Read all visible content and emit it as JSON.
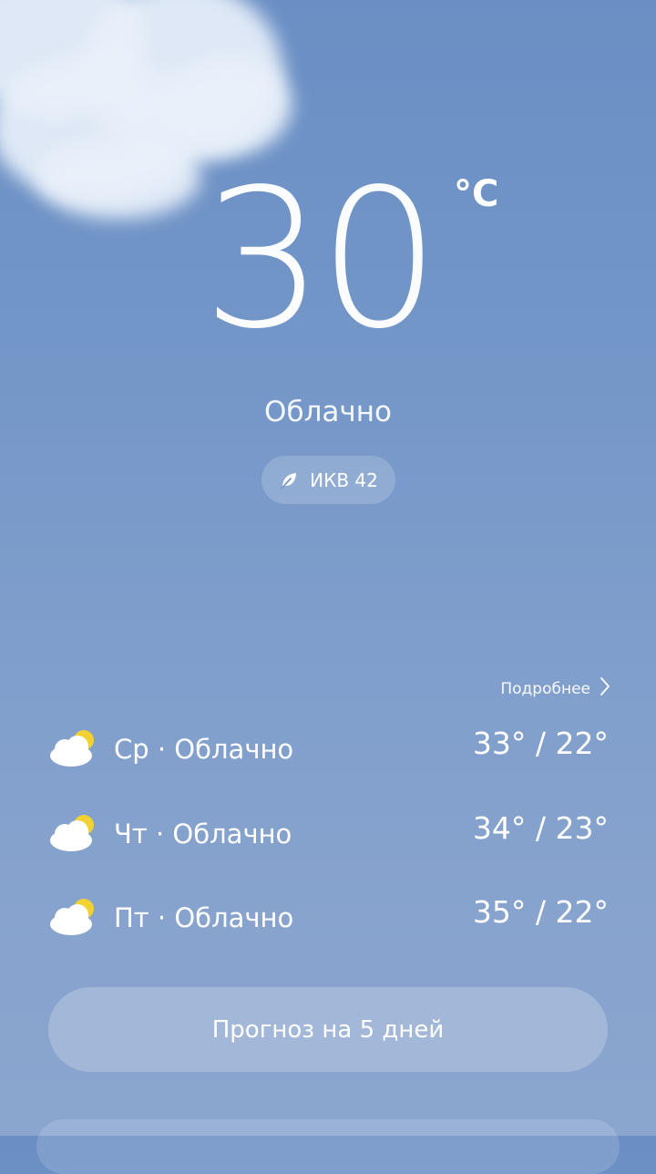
{
  "current": {
    "temperature": "30",
    "unit": "°C",
    "condition": "Облачно",
    "aqi_label": "ИКВ 42"
  },
  "forecast": {
    "more_label": "Подробнее",
    "days": [
      {
        "label": "Ср · Облачно",
        "temps": "33° / 22°",
        "icon": "partly-cloudy-icon"
      },
      {
        "label": "Чт · Облачно",
        "temps": "34° / 23°",
        "icon": "partly-cloudy-icon"
      },
      {
        "label": "Пт · Облачно",
        "temps": "35° / 22°",
        "icon": "partly-cloudy-icon"
      }
    ],
    "five_day_button": "Прогноз на 5 дней"
  },
  "colors": {
    "sky_top": "#6a8fc4",
    "sky_bottom": "#8aa6cf",
    "sun": "#f2d233"
  }
}
